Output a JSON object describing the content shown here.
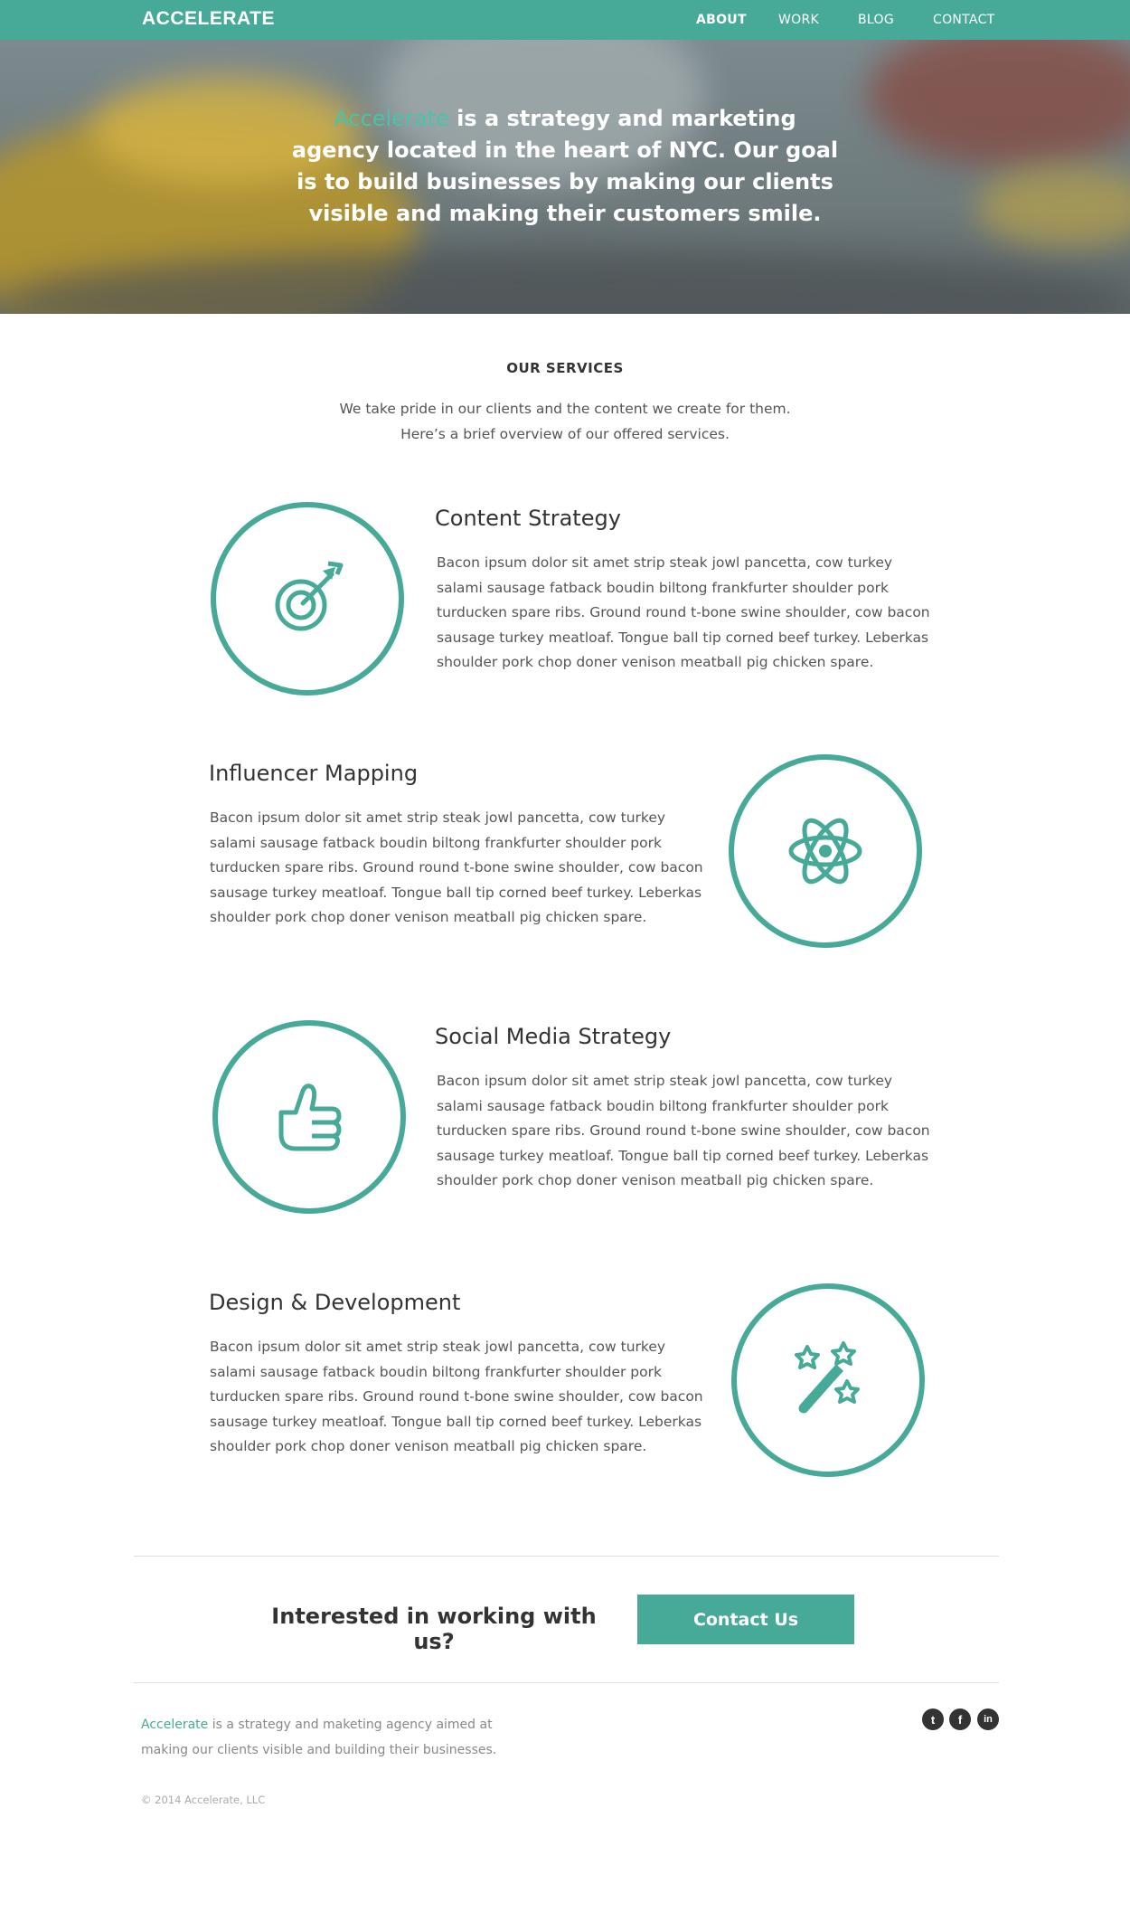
{
  "nav": {
    "brand": "ACCELERATE",
    "items": [
      {
        "label": "ABOUT",
        "active": true
      },
      {
        "label": "WORK",
        "active": false
      },
      {
        "label": "BLOG",
        "active": false
      },
      {
        "label": "CONTACT",
        "active": false
      }
    ]
  },
  "hero": {
    "accent_word": "Accelerate",
    "text": " is a strategy and marketing agency located in the heart of NYC. Our goal is to build businesses by making our clients visible and making their customers smile."
  },
  "services": {
    "title": "OUR SERVICES",
    "subtitle_line1": "We take pride in our clients and the content we create for them.",
    "subtitle_line2": "Here’s a brief overview of our offered services.",
    "items": [
      {
        "title": "Content Strategy",
        "icon": "target-arrow-icon",
        "body": "Bacon ipsum dolor sit amet strip steak jowl pancetta, cow turkey salami sausage fatback boudin biltong frankfurter shoulder pork turducken spare ribs. Ground round t-bone swine shoulder, cow bacon sausage turkey meatloaf. Tongue ball tip corned beef turkey. Leberkas shoulder pork chop doner venison meatball pig chicken spare."
      },
      {
        "title": "Influencer Mapping",
        "icon": "atom-icon",
        "body": "Bacon ipsum dolor sit amet strip steak jowl pancetta, cow turkey salami sausage fatback boudin biltong frankfurter shoulder pork turducken spare ribs. Ground round t-bone swine shoulder, cow bacon sausage turkey meatloaf. Tongue ball tip corned beef turkey. Leberkas shoulder pork chop doner venison meatball pig chicken spare."
      },
      {
        "title": "Social Media Strategy",
        "icon": "thumbs-up-icon",
        "body": "Bacon ipsum dolor sit amet strip steak jowl pancetta, cow turkey salami sausage fatback boudin biltong frankfurter shoulder pork turducken spare ribs. Ground round t-bone swine shoulder, cow bacon sausage turkey meatloaf. Tongue ball tip corned beef turkey. Leberkas shoulder pork chop doner venison meatball pig chicken spare."
      },
      {
        "title": "Design & Development",
        "icon": "magic-wand-icon",
        "body": "Bacon ipsum dolor sit amet strip steak jowl pancetta, cow turkey salami sausage fatback boudin biltong frankfurter shoulder pork turducken spare ribs. Ground round t-bone swine shoulder, cow bacon sausage turkey meatloaf. Tongue ball tip corned beef turkey. Leberkas shoulder pork chop doner venison meatball pig chicken spare."
      }
    ]
  },
  "cta": {
    "text": "Interested in working with us?",
    "button": "Contact Us"
  },
  "footer": {
    "accent_word": "Accelerate",
    "text": " is a strategy and maketing agency aimed at making our clients visible and building their businesses.",
    "copyright": "© 2014 Accelerate, LLC",
    "social": [
      {
        "name": "twitter-icon",
        "glyph": "t"
      },
      {
        "name": "facebook-icon",
        "glyph": "f"
      },
      {
        "name": "linkedin-icon",
        "glyph": "in"
      }
    ]
  },
  "colors": {
    "accent": "#47a997",
    "text": "#333333",
    "muted": "#555555"
  }
}
